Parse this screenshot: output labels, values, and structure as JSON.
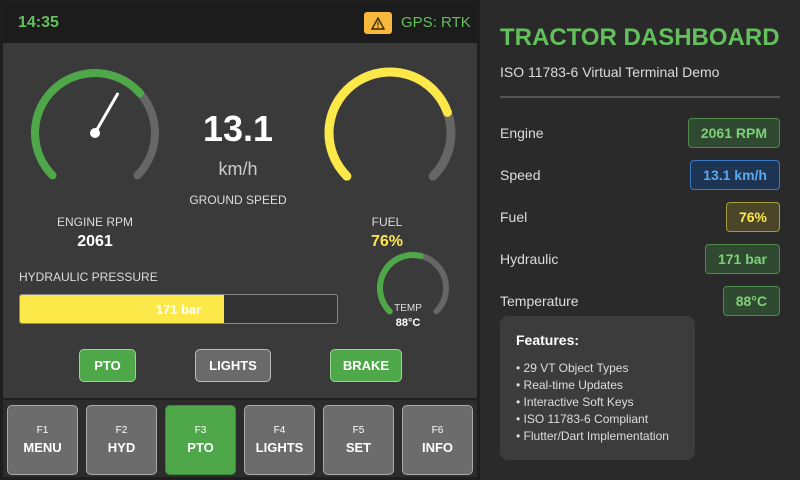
{
  "terminal": {
    "clock": "14:35",
    "gps_status": "GPS: RTK",
    "warning_icon": "warning-triangle-icon",
    "engine": {
      "label": "ENGINE RPM",
      "value": "2061",
      "fraction": 0.68
    },
    "speed": {
      "value": "13.1",
      "unit": "km/h",
      "label": "GROUND SPEED"
    },
    "fuel": {
      "label": "FUEL",
      "value": "76%",
      "fraction": 0.76
    },
    "hydraulic": {
      "label": "HYDRAULIC PRESSURE",
      "value": "171 bar",
      "fraction": 0.645
    },
    "temp": {
      "label": "TEMP",
      "value": "88°C",
      "fraction": 0.55
    },
    "toggles": [
      {
        "label": "PTO",
        "on": true
      },
      {
        "label": "LIGHTS",
        "on": false
      },
      {
        "label": "BRAKE",
        "on": true
      }
    ],
    "softkeys": [
      {
        "key": "F1",
        "label": "MENU",
        "active": false
      },
      {
        "key": "F2",
        "label": "HYD",
        "active": false
      },
      {
        "key": "F3",
        "label": "PTO",
        "active": true
      },
      {
        "key": "F4",
        "label": "LIGHTS",
        "active": false
      },
      {
        "key": "F5",
        "label": "SET",
        "active": false
      },
      {
        "key": "F6",
        "label": "INFO",
        "active": false
      }
    ]
  },
  "info": {
    "title": "TRACTOR DASHBOARD",
    "subtitle": "ISO 11783-6 Virtual Terminal Demo",
    "rows": [
      {
        "label": "Engine",
        "value": "2061 RPM",
        "style": "green"
      },
      {
        "label": "Speed",
        "value": "13.1 km/h",
        "style": "blue"
      },
      {
        "label": "Fuel",
        "value": "76%",
        "style": "yellow"
      },
      {
        "label": "Hydraulic",
        "value": "171 bar",
        "style": "green"
      },
      {
        "label": "Temperature",
        "value": "88°C",
        "style": "green"
      }
    ],
    "features": {
      "title": "Features:",
      "items": [
        "• 29 VT Object Types",
        "• Real-time Updates",
        "• Interactive Soft Keys",
        "• ISO 11783-6 Compliant",
        "• Flutter/Dart Implementation"
      ]
    }
  },
  "colors": {
    "green": "#63c05c",
    "gauge_green": "#4ea84a",
    "yellow": "#fde84a",
    "track": "#666666",
    "warning": "#f6b93b"
  }
}
